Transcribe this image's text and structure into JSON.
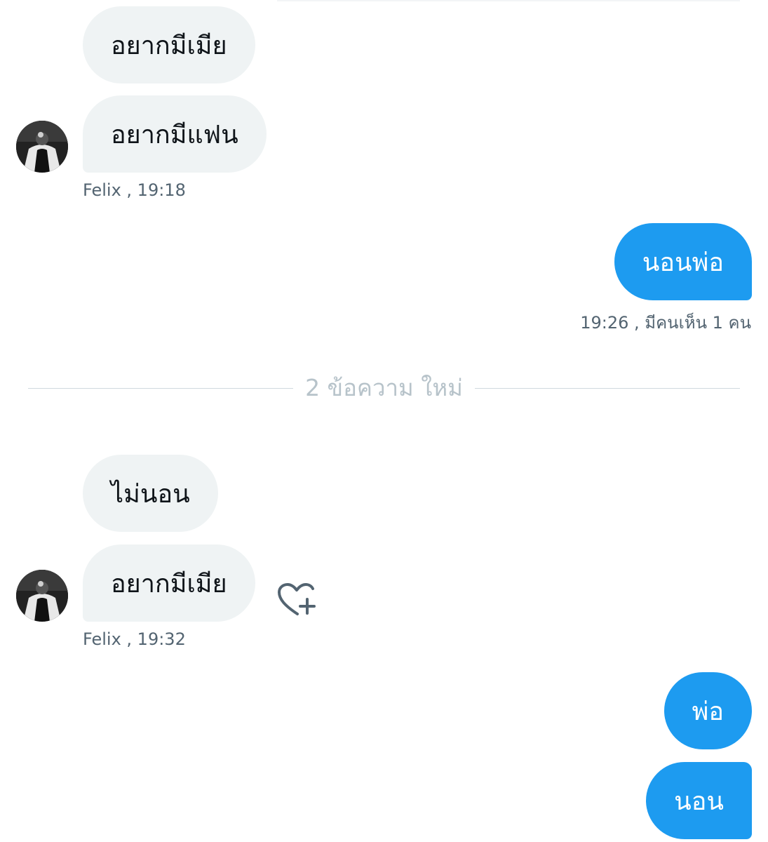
{
  "conversation": {
    "messages": [
      {
        "text": "อยากมีเมีย",
        "sender": "Felix",
        "direction": "incoming"
      },
      {
        "text": "อยากมีแฟน",
        "sender": "Felix",
        "direction": "incoming"
      },
      {
        "text": "นอนพ่อ",
        "direction": "outgoing"
      },
      {
        "text": "ไม่นอน",
        "sender": "Felix",
        "direction": "incoming"
      },
      {
        "text": "อยากมีเมีย",
        "sender": "Felix",
        "direction": "incoming"
      },
      {
        "text": "พ่อ",
        "direction": "outgoing"
      },
      {
        "text": "นอน",
        "direction": "outgoing"
      }
    ],
    "meta": {
      "group1": "Felix  , 19:18",
      "group2": "19:26 , มีคนเห็น 1 คน",
      "group3": "Felix  , 19:32"
    },
    "divider_label": "2 ข้อความ ใหม่",
    "icons": {
      "avatar": "avatar-image",
      "react": "heart-plus-icon"
    }
  },
  "colors": {
    "outgoing_bubble": "#1d9bf0",
    "incoming_bubble": "#eff3f4",
    "meta_text": "#536471",
    "divider": "#cfd9de"
  }
}
